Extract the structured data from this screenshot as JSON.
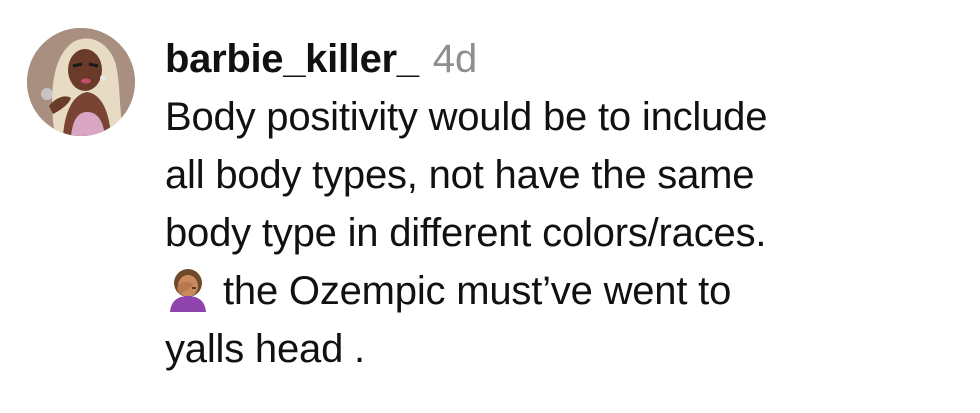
{
  "comment": {
    "username": "barbie_killer_",
    "timestamp": "4d",
    "text_lines": [
      "Body positivity would be to include",
      "all body types, not have the same",
      "body type in different colors/races.",
      "the Ozempic must’ve went to",
      "yalls head ."
    ],
    "emoji": "woman-facepalming-icon"
  },
  "colors": {
    "text": "#111111",
    "timestamp": "#8e8e8e",
    "background": "#ffffff"
  }
}
